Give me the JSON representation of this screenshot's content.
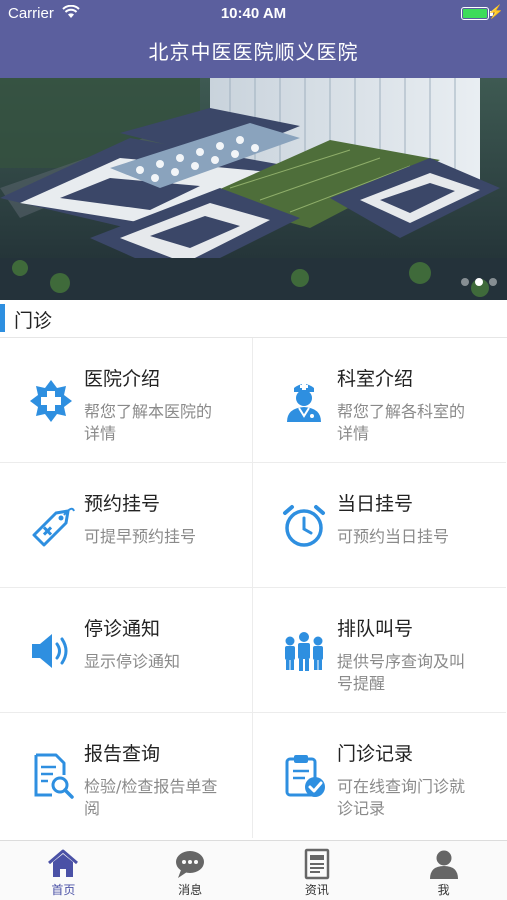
{
  "status_bar": {
    "carrier": "Carrier",
    "time": "10:40 AM",
    "battery_level": 1.0
  },
  "nav": {
    "title": "北京中医医院顺义医院"
  },
  "banner": {
    "slide_count": 3,
    "active_slide": 2
  },
  "section": {
    "title": "门诊"
  },
  "services": [
    {
      "title": "医院介绍",
      "desc": "帮您了解本医院的详情",
      "icon": "hospital-cross-icon"
    },
    {
      "title": "科室介绍",
      "desc": "帮您了解各科室的详情",
      "icon": "doctor-icon"
    },
    {
      "title": "预约挂号",
      "desc": "可提早预约挂号",
      "icon": "tag-icon"
    },
    {
      "title": "当日挂号",
      "desc": "可预约当日挂号",
      "icon": "alarm-clock-icon"
    },
    {
      "title": "停诊通知",
      "desc": "显示停诊通知",
      "icon": "speaker-icon"
    },
    {
      "title": "排队叫号",
      "desc": "提供号序查询及叫号提醒",
      "icon": "people-queue-icon"
    },
    {
      "title": "报告查询",
      "desc": "检验/检查报告单查阅",
      "icon": "report-search-icon"
    },
    {
      "title": "门诊记录",
      "desc": "可在线查询门诊就诊记录",
      "icon": "clipboard-check-icon"
    }
  ],
  "tabs": [
    {
      "label": "首页",
      "icon": "home-icon",
      "active": true
    },
    {
      "label": "消息",
      "icon": "chat-icon",
      "active": false
    },
    {
      "label": "资讯",
      "icon": "news-icon",
      "active": false
    },
    {
      "label": "我",
      "icon": "user-icon",
      "active": false
    }
  ],
  "colors": {
    "nav": "#5b5f9e",
    "accent": "#2e8fe0",
    "tab_active": "#4a51a6"
  }
}
